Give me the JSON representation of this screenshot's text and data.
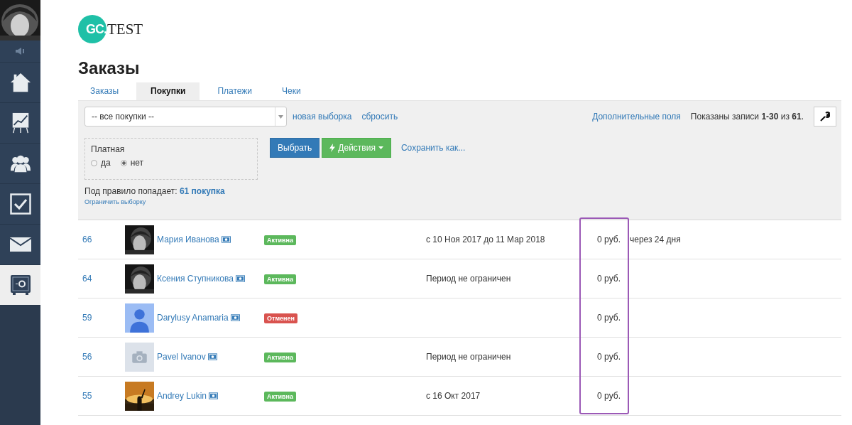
{
  "sidebar": {
    "items": [
      {
        "selected": false
      },
      {
        "selected": false
      },
      {
        "selected": false
      },
      {
        "selected": false
      },
      {
        "selected": false
      },
      {
        "selected": true
      }
    ]
  },
  "logo": {
    "mark": "GC.",
    "text": "TEST"
  },
  "title": "Заказы",
  "tabs": [
    {
      "label": "Заказы",
      "selected": false
    },
    {
      "label": "Покупки",
      "selected": true
    },
    {
      "label": "Платежи",
      "selected": false
    },
    {
      "label": "Чеки",
      "selected": false
    }
  ],
  "filter": {
    "select": "-- все покупки --",
    "links": [
      "новая выборка",
      "сбросить"
    ],
    "extra_fields": "Дополнительные поля",
    "records": "Показаны записи **1-30** из **61**.",
    "condition": {
      "label": "Платная",
      "options": [
        {
          "label": "да",
          "selected": false
        },
        {
          "label": "нет",
          "selected": true
        }
      ]
    },
    "buttons": {
      "apply": "Выбрать",
      "actions": "Действия",
      "save": "Сохранить как..."
    },
    "summary": "Под правило попадает: **61 покупка**",
    "limit": "Ограничить выборку"
  },
  "rows": [
    {
      "id": "66",
      "name": "Мария Иванова",
      "status": {
        "label": "Активна",
        "kind": "active"
      },
      "period": "с 10 Ноя 2017 до 11 Мар 2018",
      "price": "0 руб.",
      "remaining": "через 24 дня"
    },
    {
      "id": "64",
      "name": "Ксения Ступникова",
      "status": {
        "label": "Активна",
        "kind": "active"
      },
      "period": "Период не ограничен",
      "price": "0 руб."
    },
    {
      "id": "59",
      "avatar": {
        "kind": "person"
      },
      "name": "Darylusy Anamaria",
      "status": {
        "label": "Отменен",
        "kind": "cancelled"
      },
      "price": "0 руб."
    },
    {
      "id": "56",
      "avatar": {
        "kind": "camera"
      },
      "name": "Pavel Ivanov",
      "status": {
        "label": "Активна",
        "kind": "active"
      },
      "period": "Период не ограничен",
      "price": "0 руб."
    },
    {
      "id": "55",
      "name": "Andrey Lukin",
      "status": {
        "label": "Активна",
        "kind": "active"
      },
      "period": "с 16 Окт 2017",
      "price": "0 руб."
    }
  ],
  "price_highlighted": true
}
